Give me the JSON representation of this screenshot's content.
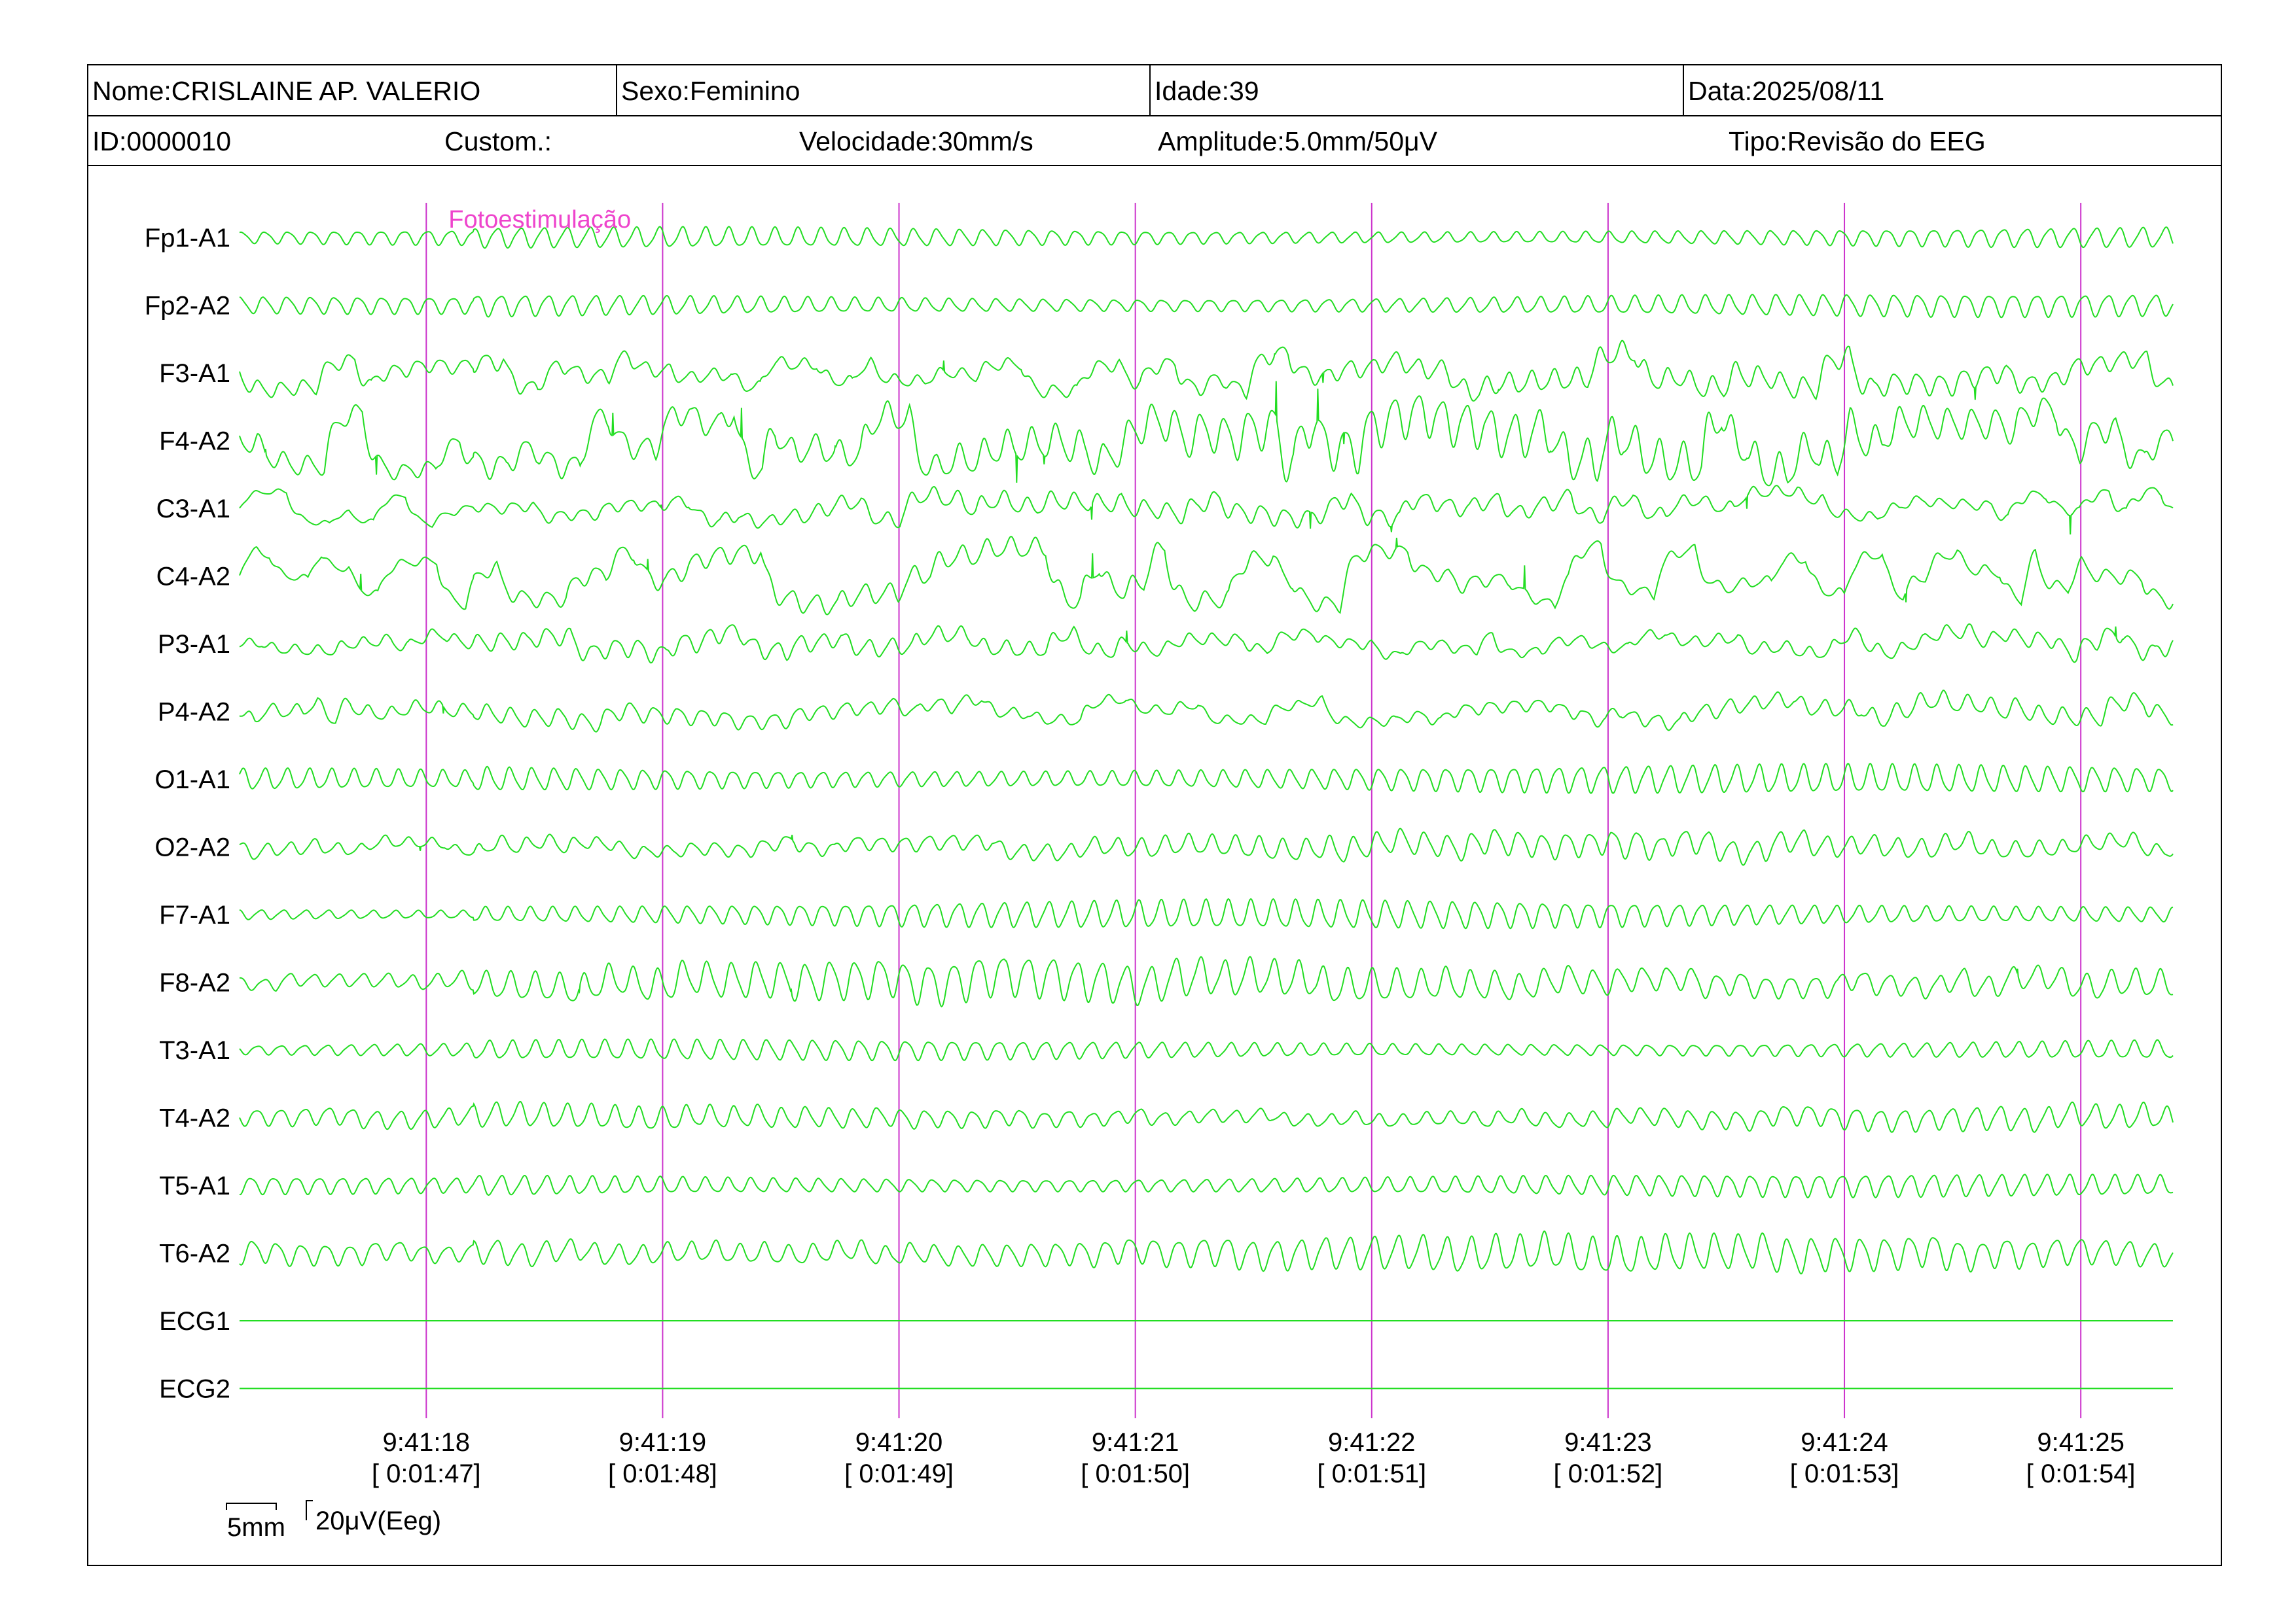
{
  "header": {
    "nome": "Nome:CRISLAINE AP. VALERIO",
    "sexo": "Sexo:Feminino",
    "idade": "Idade:39",
    "data": "Data:2025/08/11",
    "id": "ID:0000010",
    "custom": "Custom.:",
    "velocidade": "Velocidade:30mm/s",
    "amplitude": "Amplitude:5.0mm/50μV",
    "tipo": "Tipo:Revisão do EEG"
  },
  "colors": {
    "trace": "#22dd22",
    "marker": "#cc33cc",
    "annotation": "#ee44cc",
    "border": "#000000"
  },
  "chart_data": {
    "type": "line",
    "title": "",
    "xlabel": "",
    "ylabel": "",
    "channels": [
      "Fp1-A1",
      "Fp2-A2",
      "F3-A1",
      "F4-A2",
      "C3-A1",
      "C4-A2",
      "P3-A1",
      "P4-A2",
      "O1-A1",
      "O2-A2",
      "F7-A1",
      "F8-A2",
      "T3-A1",
      "T4-A2",
      "T5-A1",
      "T6-A2",
      "ECG1",
      "ECG2"
    ],
    "time_labels": [
      "9:41:18",
      "9:41:19",
      "9:41:20",
      "9:41:21",
      "9:41:22",
      "9:41:23",
      "9:41:24",
      "9:41:25"
    ],
    "elapsed_labels": [
      "[ 0:01:47]",
      "[ 0:01:48]",
      "[ 0:01:49]",
      "[ 0:01:50]",
      "[ 0:01:51]",
      "[ 0:01:52]",
      "[ 0:01:53]",
      "[ 0:01:54]"
    ],
    "annotation": {
      "text": "Fotoestimulação",
      "time": "9:41:19"
    },
    "scale_bar": {
      "time_label": "5mm",
      "amplitude_label": "20μV(Eeg)"
    },
    "flat_channels": [
      "ECG1",
      "ECG2"
    ],
    "x_range_seconds": [
      0.21,
      8.39
    ],
    "second_marks_at_seconds": [
      1,
      2,
      3,
      4,
      5,
      6,
      7,
      8
    ]
  }
}
